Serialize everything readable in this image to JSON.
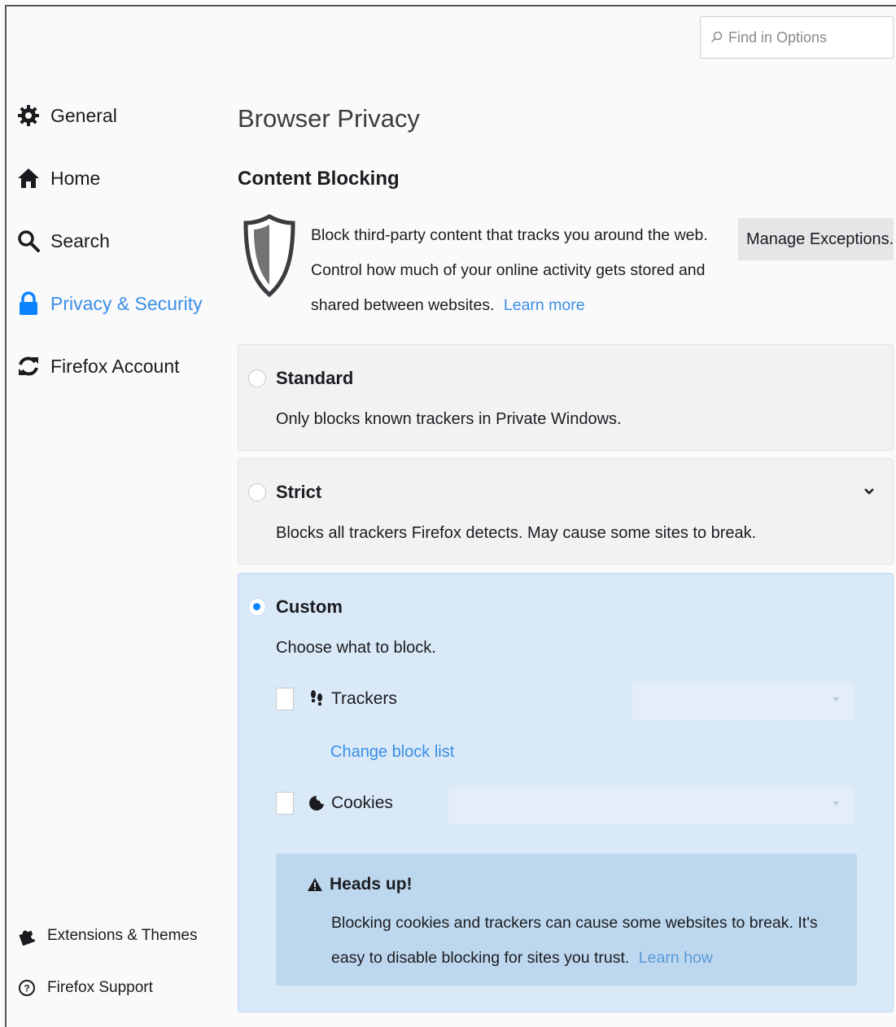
{
  "search": {
    "placeholder": "Find in Options"
  },
  "sidebar": {
    "items": [
      {
        "label": "General",
        "icon": "gear-icon"
      },
      {
        "label": "Home",
        "icon": "home-icon"
      },
      {
        "label": "Search",
        "icon": "search-icon"
      },
      {
        "label": "Privacy & Security",
        "icon": "lock-icon",
        "selected": true
      },
      {
        "label": "Firefox Account",
        "icon": "sync-icon"
      }
    ],
    "bottom": [
      {
        "label": "Extensions & Themes",
        "icon": "puzzle-icon"
      },
      {
        "label": "Firefox Support",
        "icon": "help-icon"
      }
    ]
  },
  "main": {
    "page_title": "Browser Privacy",
    "section_title": "Content Blocking",
    "description": "Block third-party content that tracks you around the web. Control how much of your online activity gets stored and shared between websites.",
    "learn_more": "Learn more",
    "manage_exceptions": "Manage Exceptions...",
    "options": {
      "standard": {
        "label": "Standard",
        "desc": "Only blocks known trackers in Private Windows."
      },
      "strict": {
        "label": "Strict",
        "desc": "Blocks all trackers Firefox detects. May cause some sites to break."
      },
      "custom": {
        "label": "Custom",
        "desc": "Choose what to block.",
        "trackers": "Trackers",
        "change_block_list": "Change block list",
        "cookies": "Cookies",
        "headsup_title": "Heads up!",
        "headsup_body": "Blocking cookies and trackers can cause some websites to break. It's easy to disable blocking for sites you trust.",
        "learn_how": "Learn how"
      }
    },
    "selected_option": "custom"
  },
  "colors": {
    "accent": "#0a84ff",
    "link": "#3a8ee6",
    "custom_bg": "#d9e9f7"
  }
}
